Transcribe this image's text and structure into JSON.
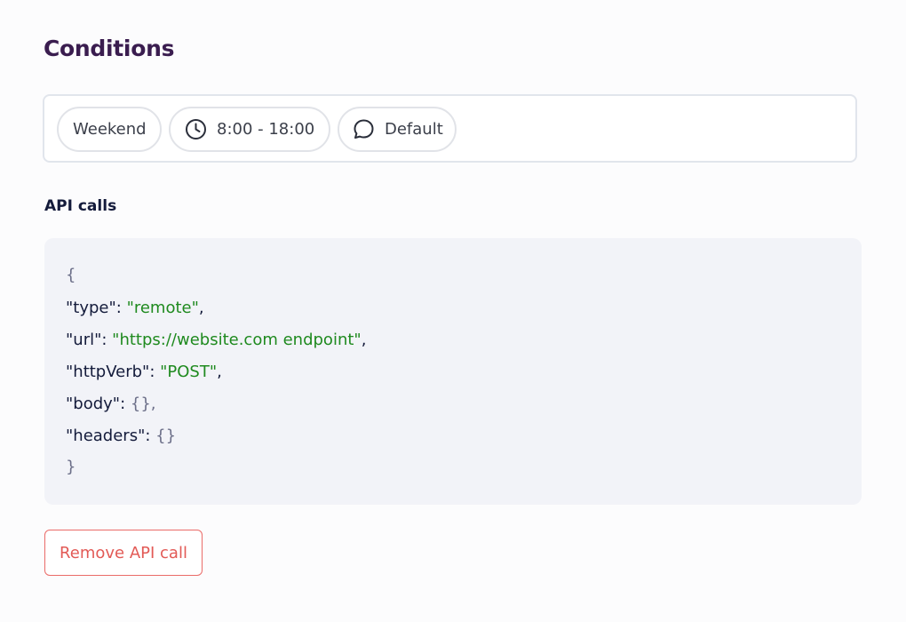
{
  "section": {
    "title": "Conditions"
  },
  "conditions": {
    "chips": [
      {
        "label": "Weekend",
        "icon": null
      },
      {
        "label": "8:00 - 18:00",
        "icon": "clock-icon"
      },
      {
        "label": "Default",
        "icon": "chat-bubble-icon"
      }
    ]
  },
  "api_calls": {
    "label": "API calls",
    "code": {
      "open_brace": "{",
      "close_brace": "}",
      "lines": [
        {
          "key": "\"type\"",
          "value": "\"remote\"",
          "value_kind": "string",
          "trail": ","
        },
        {
          "key": "\"url\"",
          "value": "\"https://website.com endpoint\"",
          "value_kind": "string",
          "trail": ","
        },
        {
          "key": "\"httpVerb\"",
          "value": "\"POST\"",
          "value_kind": "string",
          "trail": ","
        },
        {
          "key": "\"body\"",
          "value": "{}",
          "value_kind": "object",
          "trail": ","
        },
        {
          "key": "\"headers\"",
          "value": "{}",
          "value_kind": "object",
          "trail": ""
        }
      ]
    },
    "remove_button_label": "Remove API call"
  },
  "colors": {
    "title": "#3a1d4f",
    "string_value": "#1f8a1f",
    "danger": "#e25a56",
    "code_background": "#f2f3f8"
  }
}
